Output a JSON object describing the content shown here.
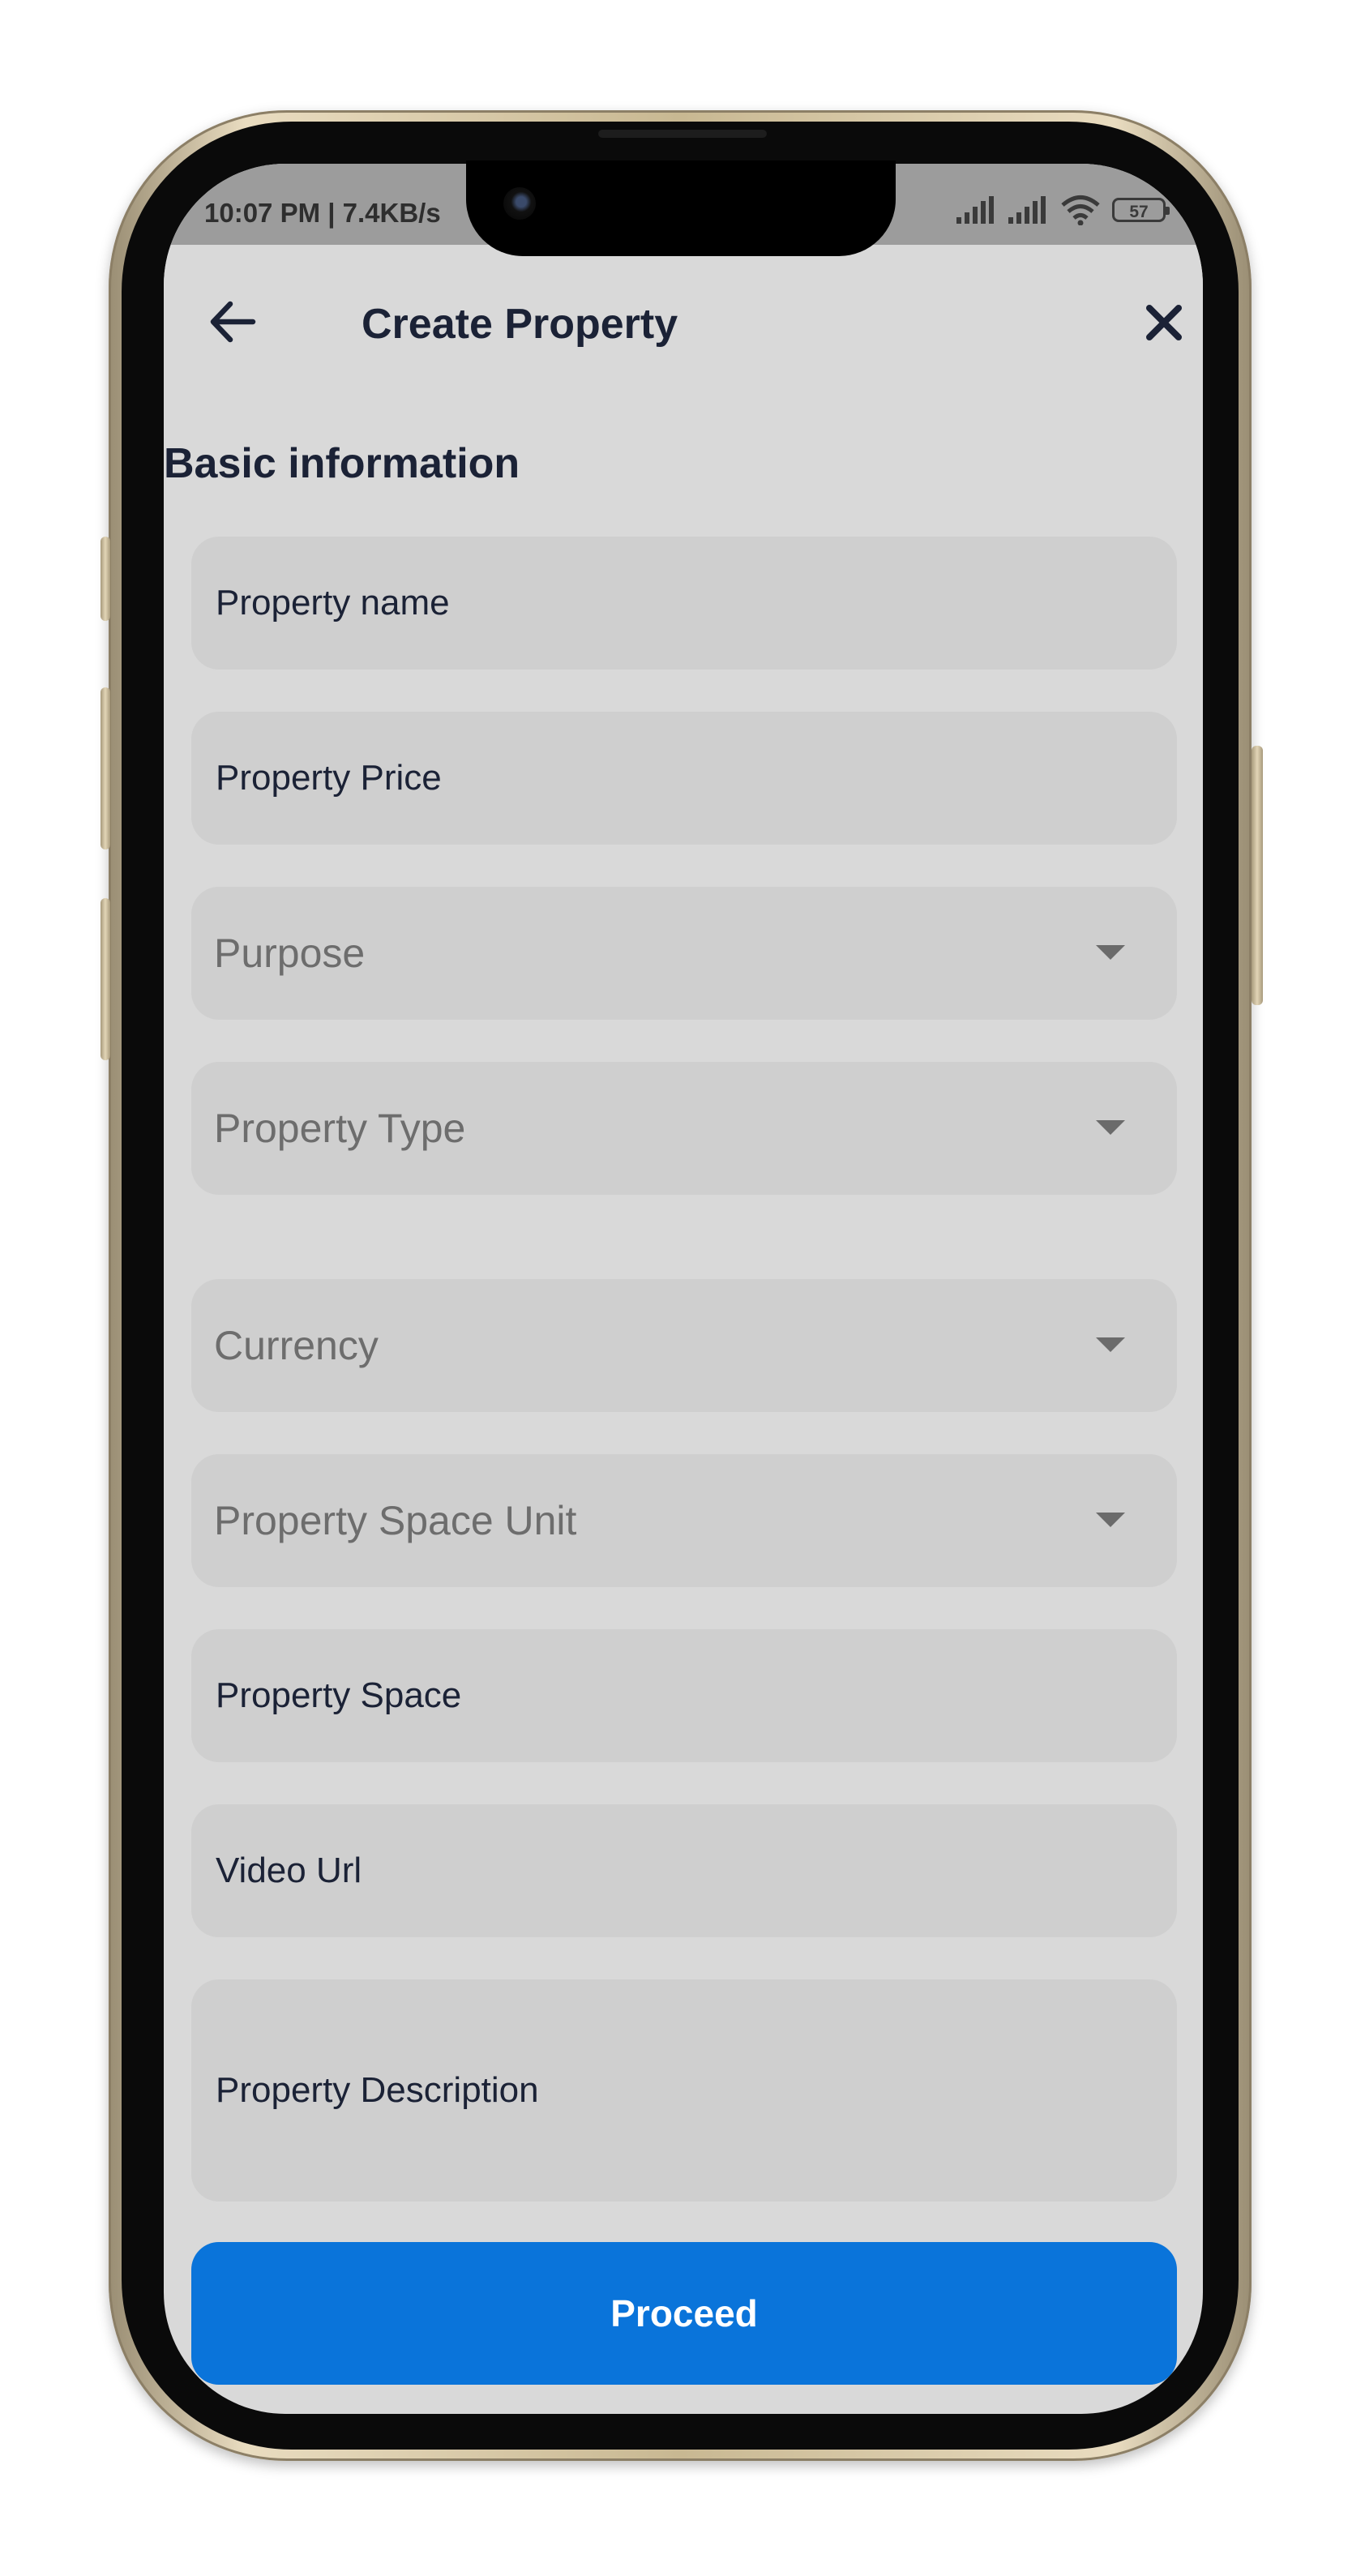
{
  "status_bar": {
    "time_text": "10:07 PM | 7.4KB/s",
    "battery_level": "57"
  },
  "header": {
    "title": "Create Property",
    "back_icon": "arrow-left-icon",
    "close_icon": "close-icon"
  },
  "form": {
    "section_title": "Basic information",
    "property_name_placeholder": "Property name",
    "property_price_placeholder": "Property Price",
    "purpose_label": "Purpose",
    "property_type_label": "Property Type",
    "currency_label": "Currency",
    "space_unit_label": "Property Space Unit",
    "property_space_placeholder": "Property Space",
    "video_url_placeholder": "Video Url",
    "description_placeholder": "Property Description"
  },
  "actions": {
    "proceed_label": "Proceed"
  },
  "colors": {
    "primary": "#0a74da",
    "text_dark": "#1b2236",
    "background": "#d9d9d9",
    "field_bg": "#cfcfcf"
  }
}
